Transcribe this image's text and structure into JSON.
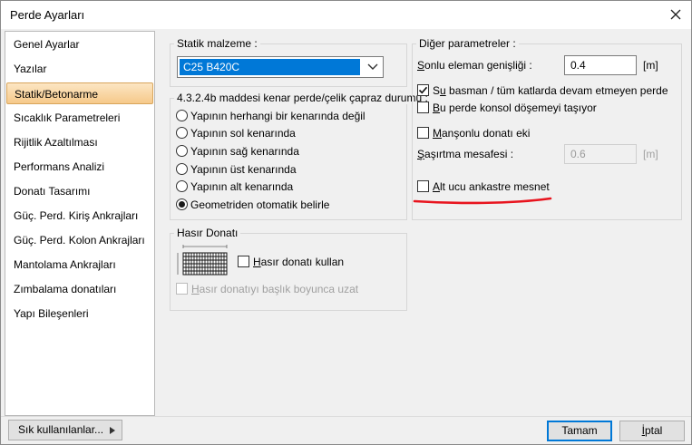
{
  "window": {
    "title": "Perde Ayarları"
  },
  "sidebar": {
    "items": [
      {
        "label": "Genel Ayarlar"
      },
      {
        "label": "Yazılar"
      },
      {
        "label": "Statik/Betonarme"
      },
      {
        "label": "Sıcaklık Parametreleri"
      },
      {
        "label": "Rijitlik Azaltılması"
      },
      {
        "label": "Performans Analizi"
      },
      {
        "label": "Donatı Tasarımı"
      },
      {
        "label": "Güç. Perd. Kiriş Ankrajları"
      },
      {
        "label": "Güç. Perd. Kolon Ankrajları"
      },
      {
        "label": "Mantolama Ankrajları"
      },
      {
        "label": "Zımbalama donatıları"
      },
      {
        "label": "Yapı Bileşenleri"
      }
    ],
    "active_index": 2
  },
  "static_material": {
    "title": "Statik malzeme :",
    "selected": "C25 B420C"
  },
  "edge_wall": {
    "title": "4.3.2.4b maddesi kenar perde/çelik çapraz durumu :",
    "options": [
      {
        "label": "Yapının herhangi bir kenarında değil",
        "checked": false
      },
      {
        "label": "Yapının sol kenarında",
        "checked": false
      },
      {
        "label": "Yapının sağ kenarında",
        "checked": false
      },
      {
        "label": "Yapının üst kenarında",
        "checked": false
      },
      {
        "label": "Yapının alt kenarında",
        "checked": false
      },
      {
        "label": "Geometriden otomatik belirle",
        "checked": true
      }
    ]
  },
  "mesh": {
    "title": "Hasır Donatı",
    "use_label_u": "H",
    "use_label_rest": "asır donatı kullan",
    "use_checked": false,
    "along_label_u": "H",
    "along_label_rest": "asır donatıyı başlık boyunca uzat",
    "along_checked": false,
    "along_disabled": true,
    "icon": "mesh-reinforcement-icon"
  },
  "other_params": {
    "title": "Diğer parametreler :",
    "fe_width_u": "S",
    "fe_width_rest": "onlu eleman genişliği :",
    "fe_width_value": "0.4",
    "fe_width_unit": "[m]",
    "groundwater_u": "u",
    "groundwater_pre": "S",
    "groundwater_rest": " basman / tüm katlarda devam etmeyen perde",
    "groundwater_checked": true,
    "cantilever_u": "B",
    "cantilever_rest": "u perde konsol döşemeyi taşıyor",
    "cantilever_checked": false,
    "coupler_u": "M",
    "coupler_rest": "anşonlu donatı eki",
    "coupler_checked": false,
    "stagger_u": "Ş",
    "stagger_rest": "aşırtma mesafesi :",
    "stagger_value": "0.6",
    "stagger_unit": "[m]",
    "fixed_u": "A",
    "fixed_rest": "lt ucu ankastre mesnet",
    "fixed_checked": false
  },
  "footer": {
    "frequent_label": "Sık kullanılanlar...",
    "ok_label": "Tamam",
    "cancel_u": "İ",
    "cancel_rest": "ptal"
  },
  "colors": {
    "selection": "#0078d7",
    "active_item_top": "#fce6c3",
    "active_item_bottom": "#f6c98a",
    "annotation_underline": "#e8141e"
  }
}
